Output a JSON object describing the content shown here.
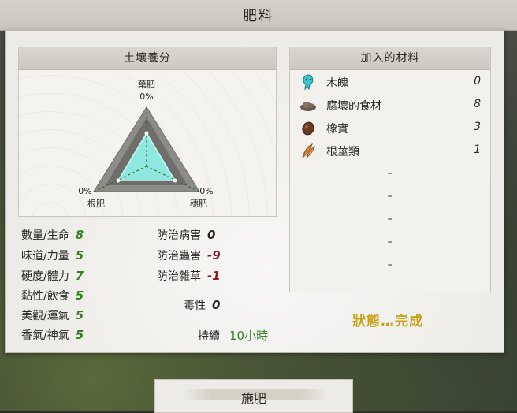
{
  "window": {
    "title": "肥料"
  },
  "soil": {
    "title": "土壤養分",
    "leaf": {
      "label": "葉肥",
      "value": "0%"
    },
    "root": {
      "label": "根肥",
      "value": "0%"
    },
    "ear": {
      "label": "穗肥",
      "value": "0%"
    }
  },
  "materials": {
    "title": "加入的材料",
    "items": [
      {
        "name": "木魄",
        "qty": "0",
        "icon": "wood-spirit-icon"
      },
      {
        "name": "腐壞的食材",
        "qty": "8",
        "icon": "rotten-food-icon"
      },
      {
        "name": "橡實",
        "qty": "3",
        "icon": "acorn-icon"
      },
      {
        "name": "根莖類",
        "qty": "1",
        "icon": "root-vegetable-icon"
      }
    ],
    "empty_slots": [
      "–",
      "–",
      "–",
      "–",
      "–"
    ]
  },
  "stats_left": [
    {
      "label": "數量/生命",
      "value": "8"
    },
    {
      "label": "味道/力量",
      "value": "5"
    },
    {
      "label": "硬度/體力",
      "value": "7"
    },
    {
      "label": "黏性/飲食",
      "value": "5"
    },
    {
      "label": "美觀/運氣",
      "value": "5"
    },
    {
      "label": "香氣/神氣",
      "value": "5"
    }
  ],
  "stats_right": [
    {
      "label": "防治病害",
      "value": "0"
    },
    {
      "label": "防治蟲害",
      "value": "-9"
    },
    {
      "label": "防治雜草",
      "value": "-1"
    }
  ],
  "toxicity": {
    "label": "毒性",
    "value": "0"
  },
  "duration": {
    "label": "持續",
    "value": "10小時"
  },
  "status": {
    "text": "狀態…完成"
  },
  "button": {
    "label": "施肥"
  },
  "colors": {
    "positive": "#3b7f2a",
    "negative": "#8a1c1c",
    "status": "#c9a21b",
    "triangle_fill": "#8fe8e0"
  }
}
